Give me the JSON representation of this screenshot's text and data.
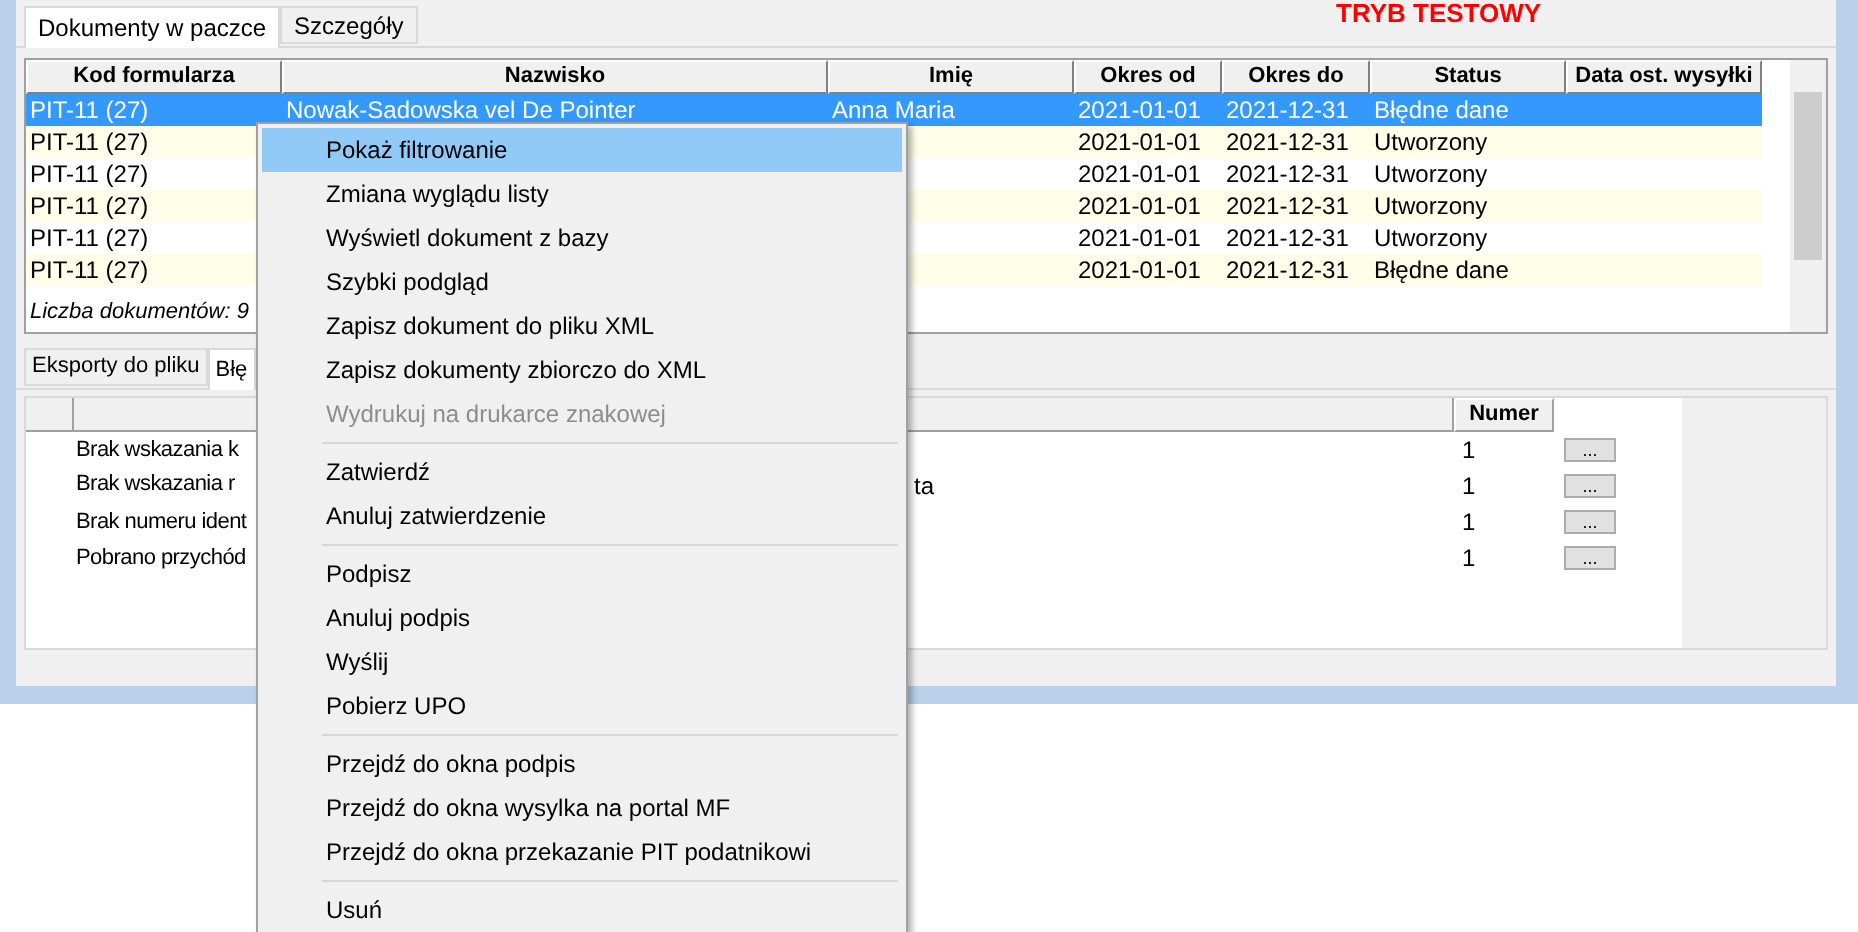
{
  "banner": "TRYB TESTOWY",
  "top_tabs": [
    {
      "label": "Dokumenty w paczce",
      "selected": true
    },
    {
      "label": "Szczegóły",
      "selected": false
    }
  ],
  "documents": {
    "columns": [
      "Kod formularza",
      "Nazwisko",
      "Imię",
      "Okres od",
      "Okres do",
      "Status",
      "Data ost. wysyłki"
    ],
    "rows": [
      {
        "code": "PIT-11 (27)",
        "surname": "Nowak-Sadowska vel De Pointer",
        "first_name": "Anna Maria",
        "from": "2021-01-01",
        "to": "2021-12-31",
        "status": "Błędne dane",
        "selected": true
      },
      {
        "code": "PIT-11 (27)",
        "from": "2021-01-01",
        "to": "2021-12-31",
        "status": "Utworzony",
        "selected": false
      },
      {
        "code": "PIT-11 (27)",
        "from": "2021-01-01",
        "to": "2021-12-31",
        "status": "Utworzony",
        "selected": false
      },
      {
        "code": "PIT-11 (27)",
        "from": "2021-01-01",
        "to": "2021-12-31",
        "status": "Utworzony",
        "selected": false
      },
      {
        "code": "PIT-11 (27)",
        "from": "2021-01-01",
        "to": "2021-12-31",
        "status": "Utworzony",
        "selected": false
      },
      {
        "code": "PIT-11 (27)",
        "from": "2021-01-01",
        "to": "2021-12-31",
        "status": "Błędne dane",
        "selected": false
      }
    ],
    "footer": "Liczba dokumentów: 9"
  },
  "bottom_tabs": [
    {
      "label": "Eksporty do pliku",
      "selected": false
    },
    {
      "label": "Błę",
      "selected": true
    }
  ],
  "errors": {
    "number_header": "Numer",
    "rows": [
      {
        "message": "Brak wskazania k",
        "number": "1",
        "button": "..."
      },
      {
        "message": "Brak wskazania r",
        "tail": "ta",
        "number": "1",
        "button": "..."
      },
      {
        "message": "Brak numeru ident",
        "number": "1",
        "button": "..."
      },
      {
        "message": "Pobrano przychód",
        "number": "1",
        "button": "..."
      }
    ]
  },
  "context_menu": [
    {
      "kind": "item",
      "label": "Pokaż filtrowanie",
      "selected": true,
      "disabled": false
    },
    {
      "kind": "item",
      "label": "Zmiana wyglądu listy",
      "selected": false,
      "disabled": false
    },
    {
      "kind": "item",
      "label": "Wyświetl dokument z bazy",
      "selected": false,
      "disabled": false
    },
    {
      "kind": "item",
      "label": "Szybki podgląd",
      "selected": false,
      "disabled": false
    },
    {
      "kind": "item",
      "label": "Zapisz dokument do pliku XML",
      "selected": false,
      "disabled": false
    },
    {
      "kind": "item",
      "label": "Zapisz dokumenty zbiorczo do XML",
      "selected": false,
      "disabled": false
    },
    {
      "kind": "item",
      "label": "Wydrukuj na drukarce znakowej",
      "selected": false,
      "disabled": true
    },
    {
      "kind": "separator"
    },
    {
      "kind": "item",
      "label": "Zatwierdź",
      "selected": false,
      "disabled": false
    },
    {
      "kind": "item",
      "label": "Anuluj zatwierdzenie",
      "selected": false,
      "disabled": false
    },
    {
      "kind": "separator"
    },
    {
      "kind": "item",
      "label": "Podpisz",
      "selected": false,
      "disabled": false
    },
    {
      "kind": "item",
      "label": "Anuluj podpis",
      "selected": false,
      "disabled": false
    },
    {
      "kind": "item",
      "label": "Wyślij",
      "selected": false,
      "disabled": false
    },
    {
      "kind": "item",
      "label": "Pobierz UPO",
      "selected": false,
      "disabled": false
    },
    {
      "kind": "separator"
    },
    {
      "kind": "item",
      "label": "Przejdź do okna podpis",
      "selected": false,
      "disabled": false
    },
    {
      "kind": "item",
      "label": "Przejdź do okna wysylka na portal MF",
      "selected": false,
      "disabled": false
    },
    {
      "kind": "item",
      "label": "Przejdź do okna przekazanie PIT podatnikowi",
      "selected": false,
      "disabled": false
    },
    {
      "kind": "separator"
    },
    {
      "kind": "item",
      "label": "Usuń",
      "selected": false,
      "disabled": false
    }
  ]
}
